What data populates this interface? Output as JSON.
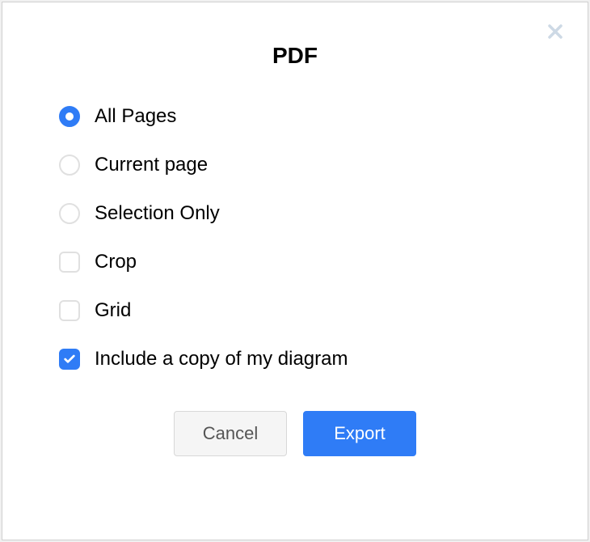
{
  "dialog": {
    "title": "PDF",
    "options": {
      "all_pages": "All Pages",
      "current_page": "Current page",
      "selection_only": "Selection Only",
      "crop": "Crop",
      "grid": "Grid",
      "include_copy": "Include a copy of my diagram"
    },
    "buttons": {
      "cancel": "Cancel",
      "export": "Export"
    }
  }
}
